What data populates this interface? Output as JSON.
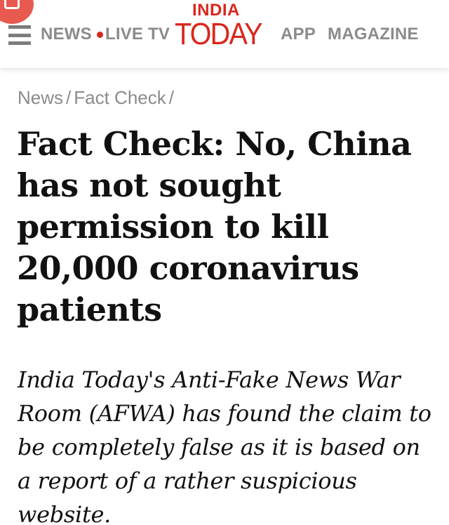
{
  "header": {
    "nav_left": [
      "NEWS",
      "LIVE TV"
    ],
    "logo_top": "INDIA",
    "logo_bottom": "TODAY",
    "nav_right": [
      "APP",
      "MAGAZINE"
    ]
  },
  "breadcrumb": {
    "items": [
      "News",
      "Fact Check"
    ],
    "separator": "/"
  },
  "article": {
    "headline": "Fact Check: No, China has not sought permission to kill 20,000 coronavirus patients",
    "summary": "India Today's Anti-Fake News War Room (AFWA) has found the claim to be completely false as it is based on a report of a rather suspicious website."
  },
  "icons": {
    "menu": "hamburger-menu-icon",
    "live": "live-dot-icon",
    "corner": "app-badge-icon"
  },
  "colors": {
    "brand_red": "#d9261c",
    "nav_gray": "#8b8b8b",
    "headline_text": "#111111",
    "badge": "#e8594f"
  }
}
